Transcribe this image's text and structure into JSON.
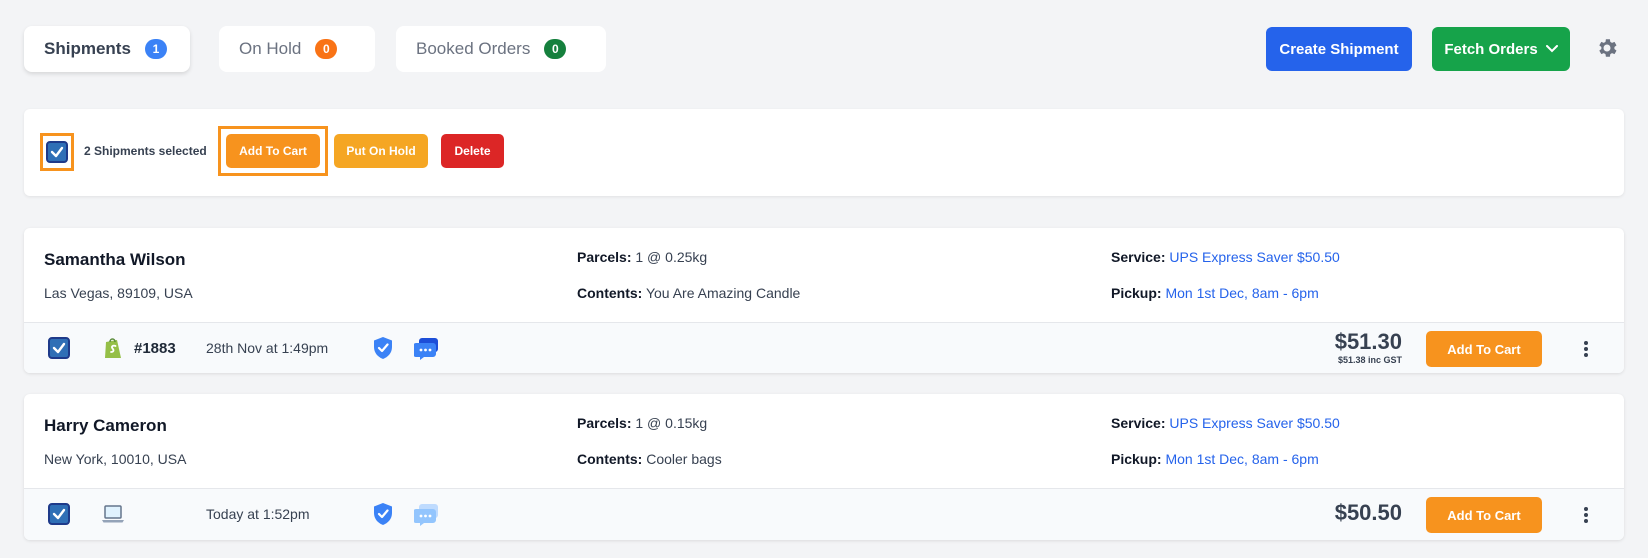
{
  "tabs": [
    {
      "label": "Shipments",
      "count": "1"
    },
    {
      "label": "On Hold",
      "count": "0"
    },
    {
      "label": "Booked Orders",
      "count": "0"
    }
  ],
  "header": {
    "create_label": "Create Shipment",
    "fetch_label": "Fetch Orders",
    "settings_icon": "gear-icon"
  },
  "selection": {
    "text": "2 Shipments selected",
    "add_to_cart": "Add To Cart",
    "put_on_hold": "Put On Hold",
    "delete": "Delete"
  },
  "shipments": [
    {
      "name": "Samantha Wilson",
      "address": "Las Vegas, 89109, USA",
      "parcels_label": "Parcels:",
      "parcels": "1 @ 0.25kg",
      "contents_label": "Contents:",
      "contents": "You Are Amazing Candle",
      "service_label": "Service:",
      "service": "UPS Express Saver $50.50",
      "pickup_label": "Pickup:",
      "pickup": "Mon 1st Dec, 8am - 6pm",
      "platform_icon": "shopify-icon",
      "order": "#1883",
      "date": "28th Nov at 1:49pm",
      "price": "$51.30",
      "price_gst": "$51.38 inc GST",
      "cart_label": "Add To Cart"
    },
    {
      "name": "Harry Cameron",
      "address": "New York, 10010, USA",
      "parcels_label": "Parcels:",
      "parcels": "1 @ 0.15kg",
      "contents_label": "Contents:",
      "contents": "Cooler bags",
      "service_label": "Service:",
      "service": "UPS Express Saver $50.50",
      "pickup_label": "Pickup:",
      "pickup": "Mon 1st Dec, 8am - 6pm",
      "platform_icon": "laptop-icon",
      "date": "Today at 1:52pm",
      "price": "$50.50",
      "cart_label": "Add To Cart"
    }
  ],
  "colors": {
    "primary_blue": "#2563eb",
    "green": "#16a34a",
    "orange": "#f7931e",
    "red": "#dc2626",
    "highlight": "#f7931e"
  }
}
